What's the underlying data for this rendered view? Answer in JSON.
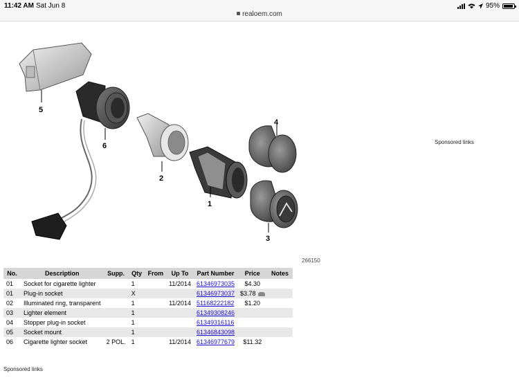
{
  "status": {
    "time": "11:42 AM",
    "date": "Sat Jun 8",
    "url": "realoem.com",
    "battery": "95%",
    "battery_level": 0.95
  },
  "diagram": {
    "callouts": [
      "5",
      "6",
      "2",
      "4",
      "1",
      "3"
    ],
    "id": "266150"
  },
  "sponsored_right": "Sponsored links",
  "sponsored_bottom": "Sponsored links",
  "table": {
    "headers": [
      "No.",
      "Description",
      "Supp.",
      "Qty",
      "From",
      "Up To",
      "Part Number",
      "Price",
      "Notes"
    ],
    "rows": [
      {
        "no": "01",
        "desc": "Socket for cigarette lighter",
        "supp": "",
        "qty": "1",
        "from": "",
        "upto": "11/2014",
        "part": "61346973035",
        "price": "$4.30",
        "notes": ""
      },
      {
        "no": "01",
        "desc": "Plug-in socket",
        "supp": "",
        "qty": "X",
        "from": "",
        "upto": "",
        "part": "61346973037",
        "price": "$3.78",
        "notes": ""
      },
      {
        "no": "02",
        "desc": "Illuminated ring, transparent",
        "supp": "",
        "qty": "1",
        "from": "",
        "upto": "11/2014",
        "part": "51168222182",
        "price": "$1.20",
        "notes": ""
      },
      {
        "no": "03",
        "desc": "Lighter element",
        "supp": "",
        "qty": "1",
        "from": "",
        "upto": "",
        "part": "61349308246",
        "price": "",
        "notes": ""
      },
      {
        "no": "04",
        "desc": "Stopper plug-in socket",
        "supp": "",
        "qty": "1",
        "from": "",
        "upto": "",
        "part": "61349316116",
        "price": "",
        "notes": ""
      },
      {
        "no": "05",
        "desc": "Socket mount",
        "supp": "",
        "qty": "1",
        "from": "",
        "upto": "",
        "part": "61346843098",
        "price": "",
        "notes": ""
      },
      {
        "no": "06",
        "desc": "Cigarette lighter socket",
        "supp": "2 POL.",
        "qty": "1",
        "from": "",
        "upto": "11/2014",
        "part": "61346977679",
        "price": "$11.32",
        "notes": ""
      }
    ]
  }
}
